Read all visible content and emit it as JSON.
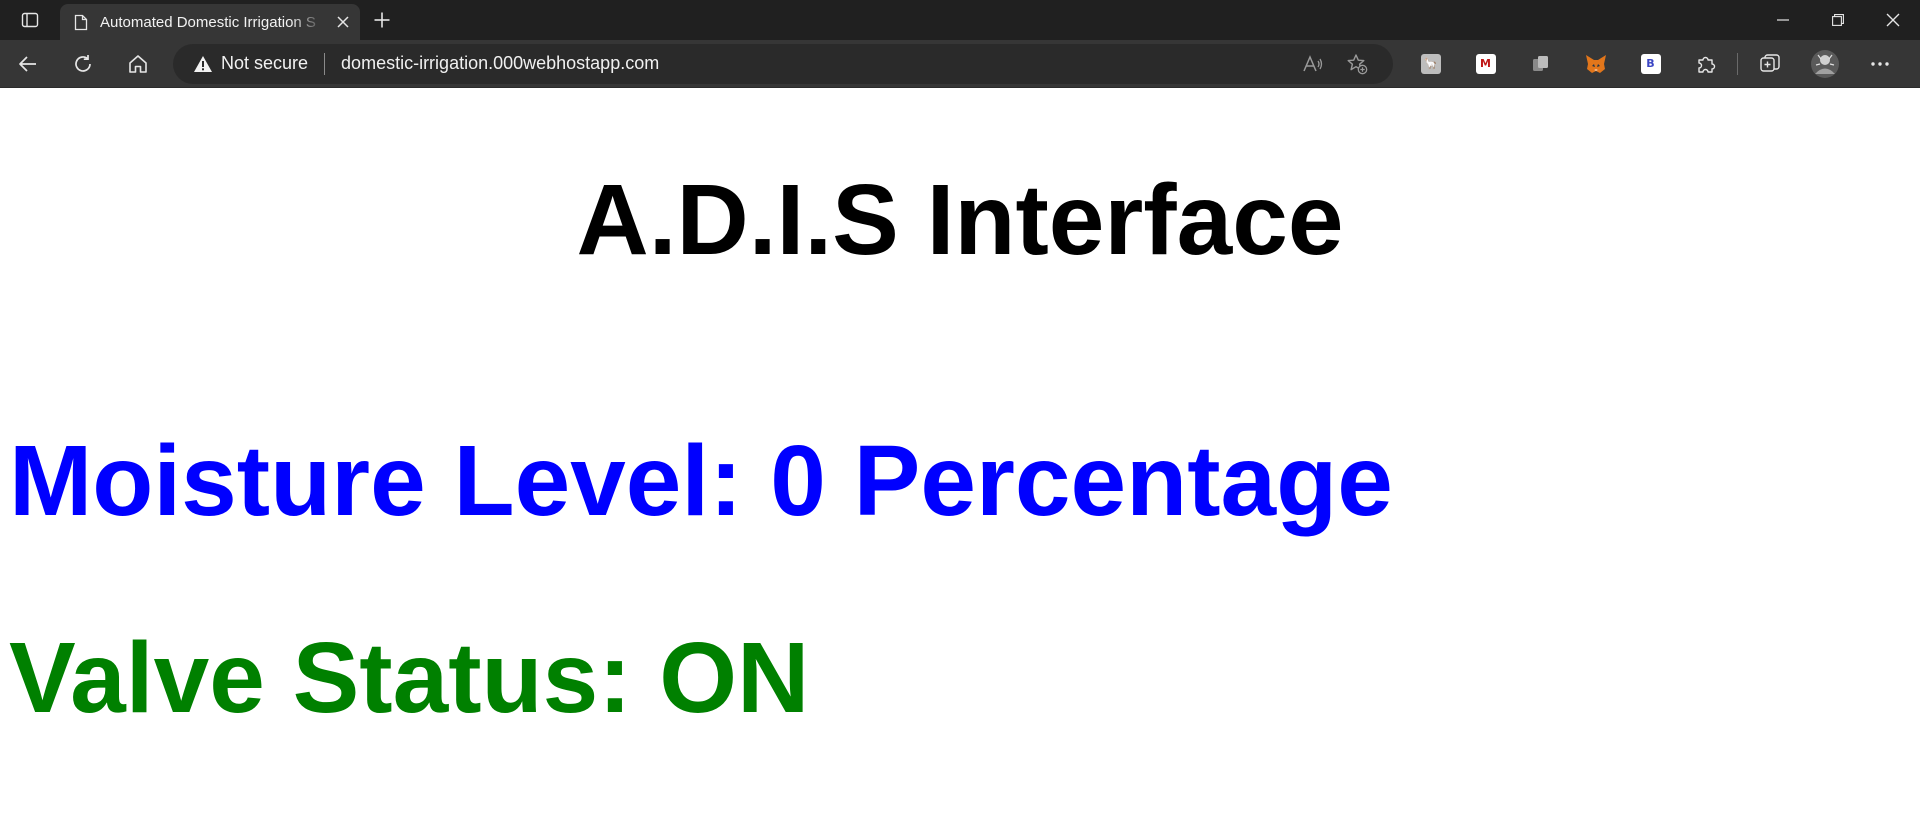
{
  "browser": {
    "tab": {
      "title": "Automated Domestic Irrigation S",
      "icon": "page-icon"
    },
    "address_bar": {
      "security_label": "Not secure",
      "url": "domestic-irrigation.000webhostapp.com"
    },
    "extensions": [
      {
        "name": "extension-1",
        "glyph": "🦙",
        "bg": "#bdbdbd",
        "fg": "#3a3a3a"
      },
      {
        "name": "mcafee-extension",
        "glyph": "M",
        "bg": "#ffffff",
        "fg": "#c01818"
      },
      {
        "name": "extension-3",
        "glyph": "",
        "bg": "#6a6a6a",
        "fg": "#cfcfcf"
      },
      {
        "name": "metamask-extension",
        "glyph": "",
        "bg": "#e2761b",
        "fg": "#e2761b"
      },
      {
        "name": "b-extension",
        "glyph": "B",
        "bg": "#ffffff",
        "fg": "#3b45c4"
      }
    ]
  },
  "page": {
    "title": "A.D.I.S Interface",
    "moisture": {
      "text": "Moisture Level: 0 Percentage",
      "color": "#0000ff"
    },
    "valve": {
      "text": "Valve Status: ON",
      "color": "#008000"
    }
  }
}
